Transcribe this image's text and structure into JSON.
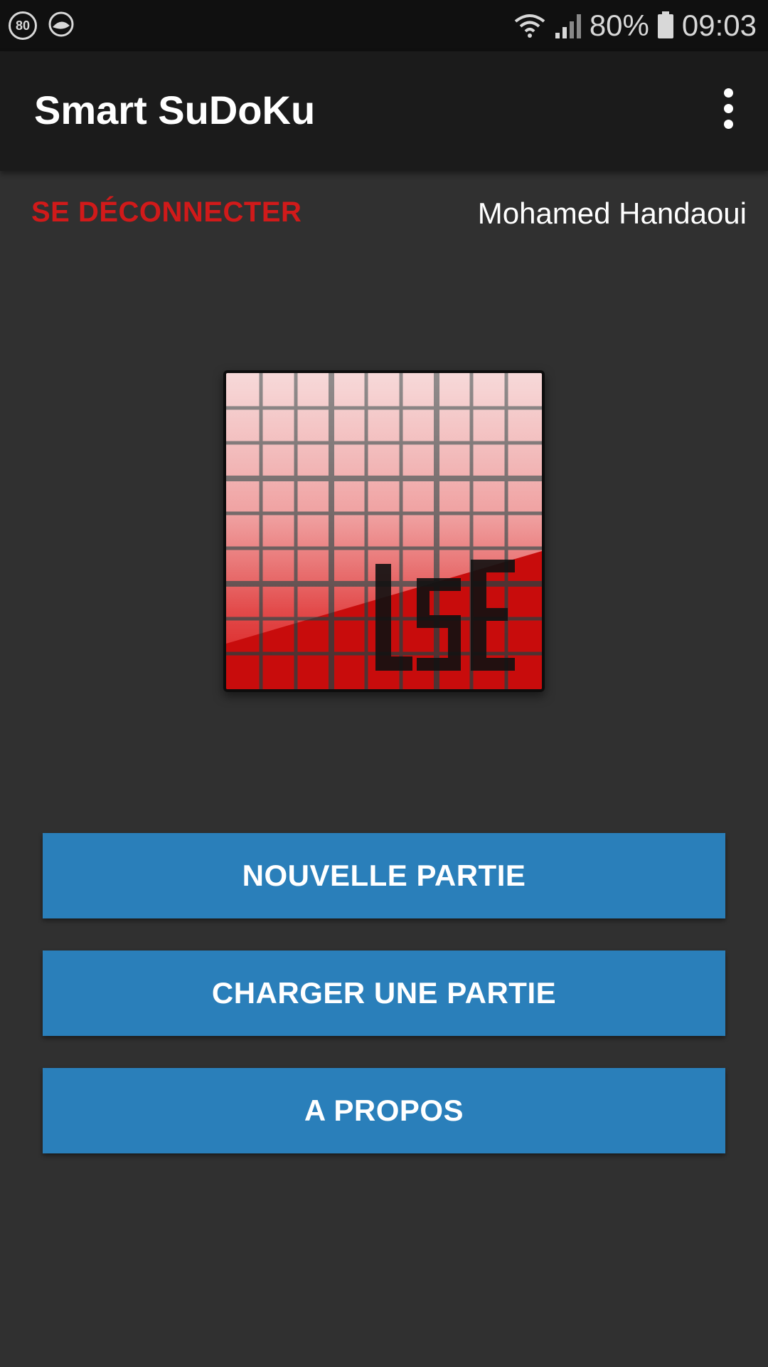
{
  "status_bar": {
    "badge_text": "80",
    "battery": "80%",
    "time": "09:03",
    "icons": [
      "speed-limit-icon",
      "game-icon",
      "wifi-icon",
      "signal-icon",
      "battery-icon"
    ]
  },
  "app_bar": {
    "title": "Smart SuDoKu",
    "overflow_icon": "more-vert-icon"
  },
  "account": {
    "logout_label": "SE DÉCONNECTER",
    "user_name": "Mohamed Handaoui"
  },
  "logo": {
    "icon": "lse-sudoku-logo"
  },
  "menu": {
    "new_game": "NOUVELLE PARTIE",
    "load_game": "CHARGER UNE PARTIE",
    "about": "A PROPOS"
  },
  "colors": {
    "background": "#303030",
    "app_bar": "#1b1b1b",
    "accent_red": "#d11a1a",
    "button_blue": "#2a7fba"
  }
}
